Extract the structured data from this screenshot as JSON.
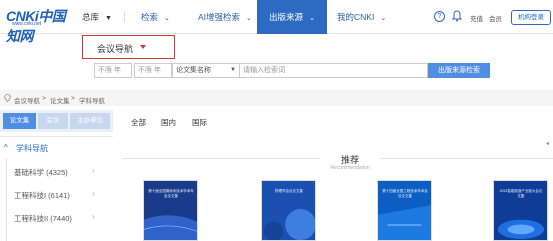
{
  "logo": {
    "mark": "CNKi中国知网",
    "sub": "www.cnki.net"
  },
  "nav": {
    "home": "总库",
    "search": "检索",
    "ai_search": "AI增强检索",
    "publication_source": "出版来源",
    "my_cnki": "我的CNKI"
  },
  "top_links": {
    "recharge": "充值",
    "member": "会员",
    "org_login": "机构登录"
  },
  "conf_nav": {
    "label": "会议导航"
  },
  "search": {
    "year_from": "不限 年",
    "year_to": "不限 年",
    "dash": "-",
    "field_select": "论文集名称",
    "input_placeholder": "请输入检索词",
    "button": "出版来源检索"
  },
  "breadcrumb": [
    "会议导航",
    "论文集",
    "学科导航"
  ],
  "left_tabs": [
    "论文集",
    "会议",
    "主办单位"
  ],
  "filter_tabs": [
    "全部",
    "国内",
    "国际"
  ],
  "subject_nav": {
    "title": "学科导航",
    "items": [
      "基础科学 (4325)",
      "工程科技I (6141)",
      "工程科技II (7440)"
    ]
  },
  "recommend": {
    "title": "推荐",
    "subtitle": "Recommendation"
  },
  "books": [
    {
      "title": "第十届全国微纳米技术学术年会论文集"
    },
    {
      "title": "物理学会议论文集"
    },
    {
      "title": "第十四届全国工程技术学术会议论文集"
    },
    {
      "title": "2024智能制造产业链大会论文集"
    }
  ],
  "colors": {
    "accent": "#2d6ac3",
    "highlight": "#d23a2e",
    "search_button": "#4f8ee3"
  }
}
